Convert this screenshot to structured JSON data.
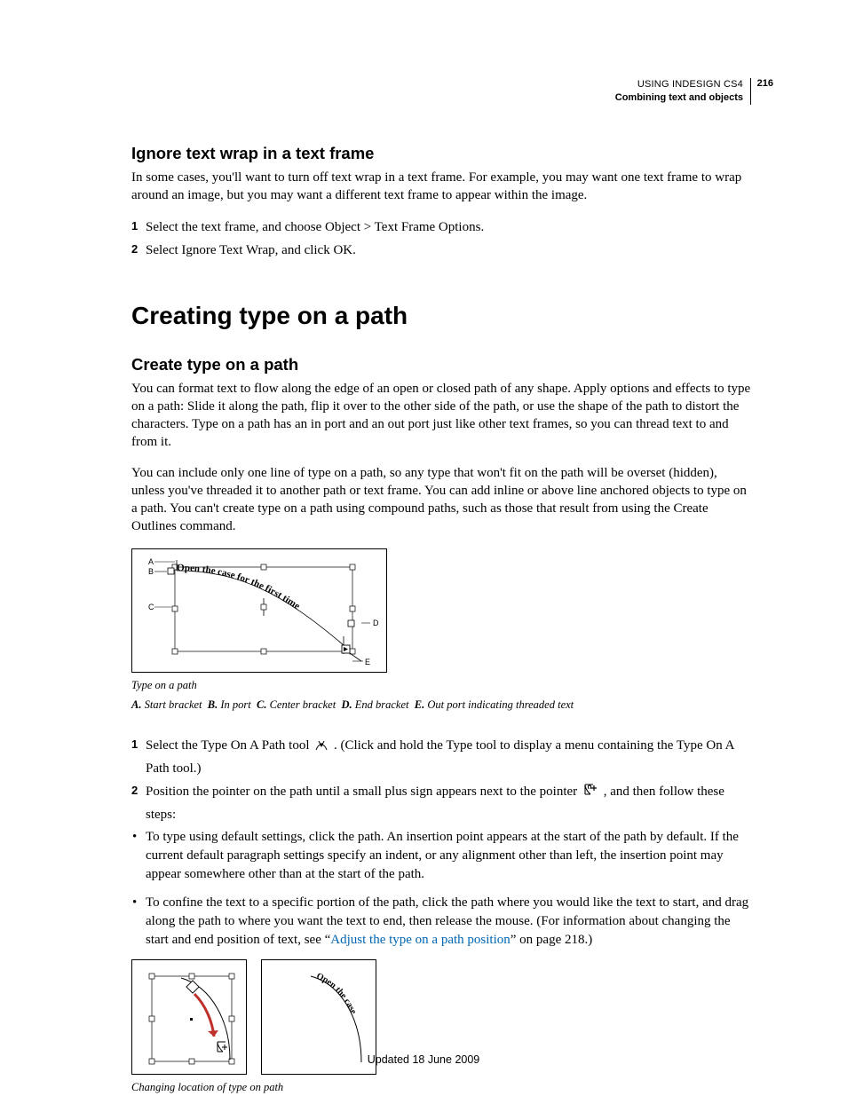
{
  "header": {
    "book": "USING INDESIGN CS4",
    "chapter": "Combining text and objects",
    "page_num": "216"
  },
  "sec1": {
    "heading": "Ignore text wrap in a text frame",
    "intro": "In some cases, you'll want to turn off text wrap in a text frame. For example, you may want one text frame to wrap around an image, but you may want a different text frame to appear within the image.",
    "step1": "Select the text frame, and choose Object > Text Frame Options.",
    "step2": "Select Ignore Text Wrap, and click OK."
  },
  "title": "Creating type on a path",
  "sec2": {
    "heading": "Create type on a path",
    "p1": "You can format text to flow along the edge of an open or closed path of any shape. Apply options and effects to type on a path: Slide it along the path, flip it over to the other side of the path, or use the shape of the path to distort the characters. Type on a path has an in port and an out port just like other text frames, so you can thread text to and from it.",
    "p2": "You can include only one line of type on a path, so any type that won't fit on the path will be overset (hidden), unless you've threaded it to another path or text frame. You can add inline or above line anchored objects to type on a path. You can't create type on a path using compound paths, such as those that result from using the Create Outlines command."
  },
  "fig1": {
    "pathtext": "Open the case for the first time",
    "labels": {
      "A": "A",
      "B": "B",
      "C": "C",
      "D": "D",
      "E": "E"
    },
    "caption_title": "Type on a path",
    "legend": {
      "A": "Start bracket",
      "B": "In port",
      "C": "Center bracket",
      "D": "End bracket",
      "E": "Out port indicating threaded text"
    }
  },
  "steps2": {
    "s1a": "Select the Type On A Path tool ",
    "s1b": " . (Click and hold the Type tool to display a menu containing the Type On A Path tool.)",
    "s2a": "Position the pointer on the path until a small plus sign appears next to the pointer ",
    "s2b": " , and then follow these steps:"
  },
  "bullets": {
    "b1": "To type using default settings, click the path. An insertion point appears at the start of the path by default. If the current default paragraph settings specify an indent, or any alignment other than left, the insertion point may appear somewhere other than at the start of the path.",
    "b2a": "To confine the text to a specific portion of the path, click the path where you would like the text to start, and drag along the path to where you want the text to end, then release the mouse. (For information about changing the start and end position of text, see “",
    "b2link": "Adjust the type on a path position",
    "b2b": "” on page 218.)"
  },
  "fig2": {
    "pathtext": "Open the case",
    "caption": "Changing location of type on path"
  },
  "footer": "Updated 18 June 2009"
}
